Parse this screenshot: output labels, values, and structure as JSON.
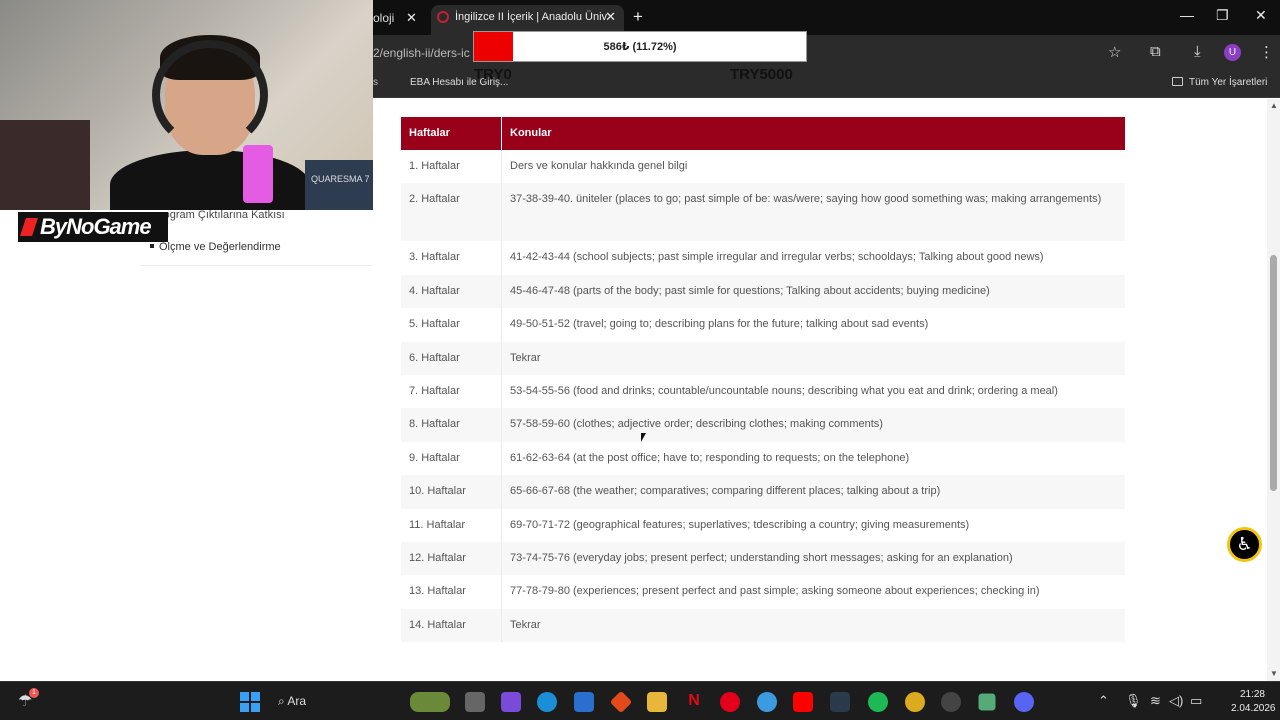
{
  "browser": {
    "prev_tab_label": "oloji",
    "active_tab_title": "İngilizce II İçerik | Anadolu Üniv",
    "url_fragment": "2/english-ii/ders-ic",
    "bookmarks": [
      {
        "label": "EBA Hesabı ile Giriş..."
      },
      {
        "label": "Tüm Yer İşaretleri"
      }
    ],
    "profile_initial": "U"
  },
  "donation_overlay": {
    "progress_text": "586₺ (11.72%)",
    "progress_fraction": 0.1172,
    "min_label": "TRY0",
    "goal_label": "TRY5000",
    "fill_color": "#ee0000"
  },
  "stream_overlay": {
    "brand": "ByNoGame",
    "shirt_text": "QUARESMA 7"
  },
  "sidebar": {
    "partial_link": "rogram Çıktılarına Katkısı",
    "items": [
      {
        "label": "Ölçme ve Değerlendirme"
      }
    ]
  },
  "syllabus": {
    "header_color": "#99001a",
    "columns": [
      "Haftalar",
      "Konular"
    ],
    "rows": [
      {
        "week": "1. Haftalar",
        "topic": "Ders ve konular hakkında genel bilgi"
      },
      {
        "week": "2. Haftalar",
        "topic": "37-38-39-40. üniteler (places to go; past simple of be: was/were; saying how good something was; making arrangements)"
      },
      {
        "week": "3. Haftalar",
        "topic": "41-42-43-44 (school subjects; past simple irregular and irregular verbs; schooldays; Talking about good news)"
      },
      {
        "week": "4. Haftalar",
        "topic": "45-46-47-48 (parts of the body; past simle for questions; Talking about accidents; buying medicine)"
      },
      {
        "week": "5. Haftalar",
        "topic": "49-50-51-52 (travel; going to; describing plans for the future; talking about sad events)"
      },
      {
        "week": "6. Haftalar",
        "topic": "Tekrar"
      },
      {
        "week": "7. Haftalar",
        "topic": "53-54-55-56 (food and drinks; countable/uncountable nouns; describing what you eat and drink; ordering a meal)"
      },
      {
        "week": "8. Haftalar",
        "topic": "57-58-59-60 (clothes; adjective order; describing clothes; making comments)"
      },
      {
        "week": "9. Haftalar",
        "topic": "61-62-63-64 (at the post office; have to; responding to requests; on the telephone)"
      },
      {
        "week": "10. Haftalar",
        "topic": "65-66-67-68 (the weather; comparatives; comparing different places; talking about a trip)"
      },
      {
        "week": "11. Haftalar",
        "topic": "69-70-71-72 (geographical features; superlatives; tdescribing a country; giving measurements)"
      },
      {
        "week": "12. Haftalar",
        "topic": "73-74-75-76 (everyday jobs; present perfect; understanding short messages; asking for an explanation)"
      },
      {
        "week": "13. Haftalar",
        "topic": "77-78-79-80 (experiences; present perfect and past simple; asking someone about experiences; checking in)"
      },
      {
        "week": "14. Haftalar",
        "topic": "Tekrar"
      }
    ]
  },
  "taskbar": {
    "search_label": "Ara",
    "time": "21:28",
    "date": "2.04.2026",
    "notification_badge": "1"
  },
  "icons": {
    "accessibility": "accessibility-icon",
    "star": "bookmark-star-icon",
    "download": "download-icon",
    "extensions": "extensions-icon"
  }
}
